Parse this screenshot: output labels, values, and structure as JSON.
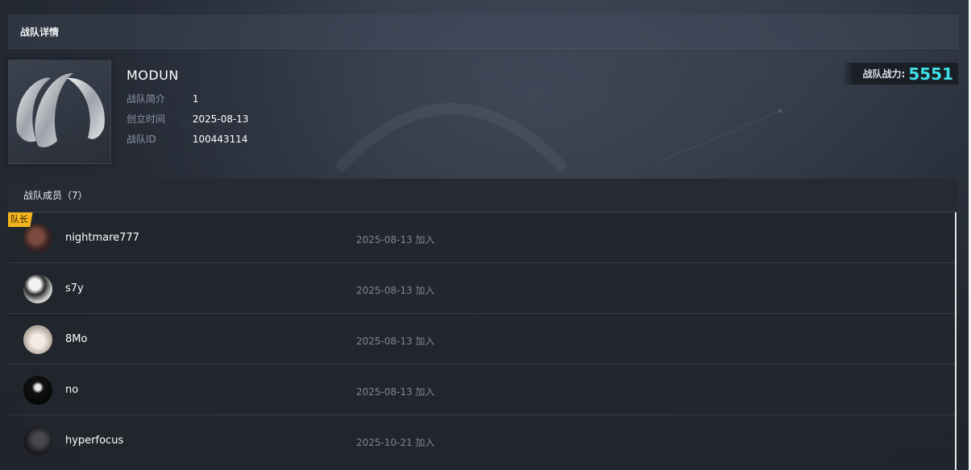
{
  "header": {
    "title": "战队详情"
  },
  "team": {
    "name": "MODUN",
    "info": [
      {
        "label": "战队简介",
        "value": "1"
      },
      {
        "label": "创立时间",
        "value": "2025-08-13"
      },
      {
        "label": "战队ID",
        "value": "100443114"
      }
    ],
    "power_label": "战队战力:",
    "power_value": "5551"
  },
  "members": {
    "title": "战队成员（7）",
    "captain_badge": "队长",
    "list": [
      {
        "name": "nightmare777",
        "joined": "2025-08-13 加入",
        "avatar": "avatar-dark-red"
      },
      {
        "name": "s7y",
        "joined": "2025-08-13 加入",
        "avatar": "avatar-bw-person"
      },
      {
        "name": "8Mo",
        "joined": "2025-08-13 加入",
        "avatar": "avatar-light"
      },
      {
        "name": "no",
        "joined": "2025-08-13 加入",
        "avatar": "avatar-black-mask"
      },
      {
        "name": "hyperfocus",
        "joined": "2025-10-21 加入",
        "avatar": "avatar-dark"
      }
    ]
  },
  "colors": {
    "power_accent": "#3ee0e6",
    "captain_badge": "#f3b41e"
  }
}
